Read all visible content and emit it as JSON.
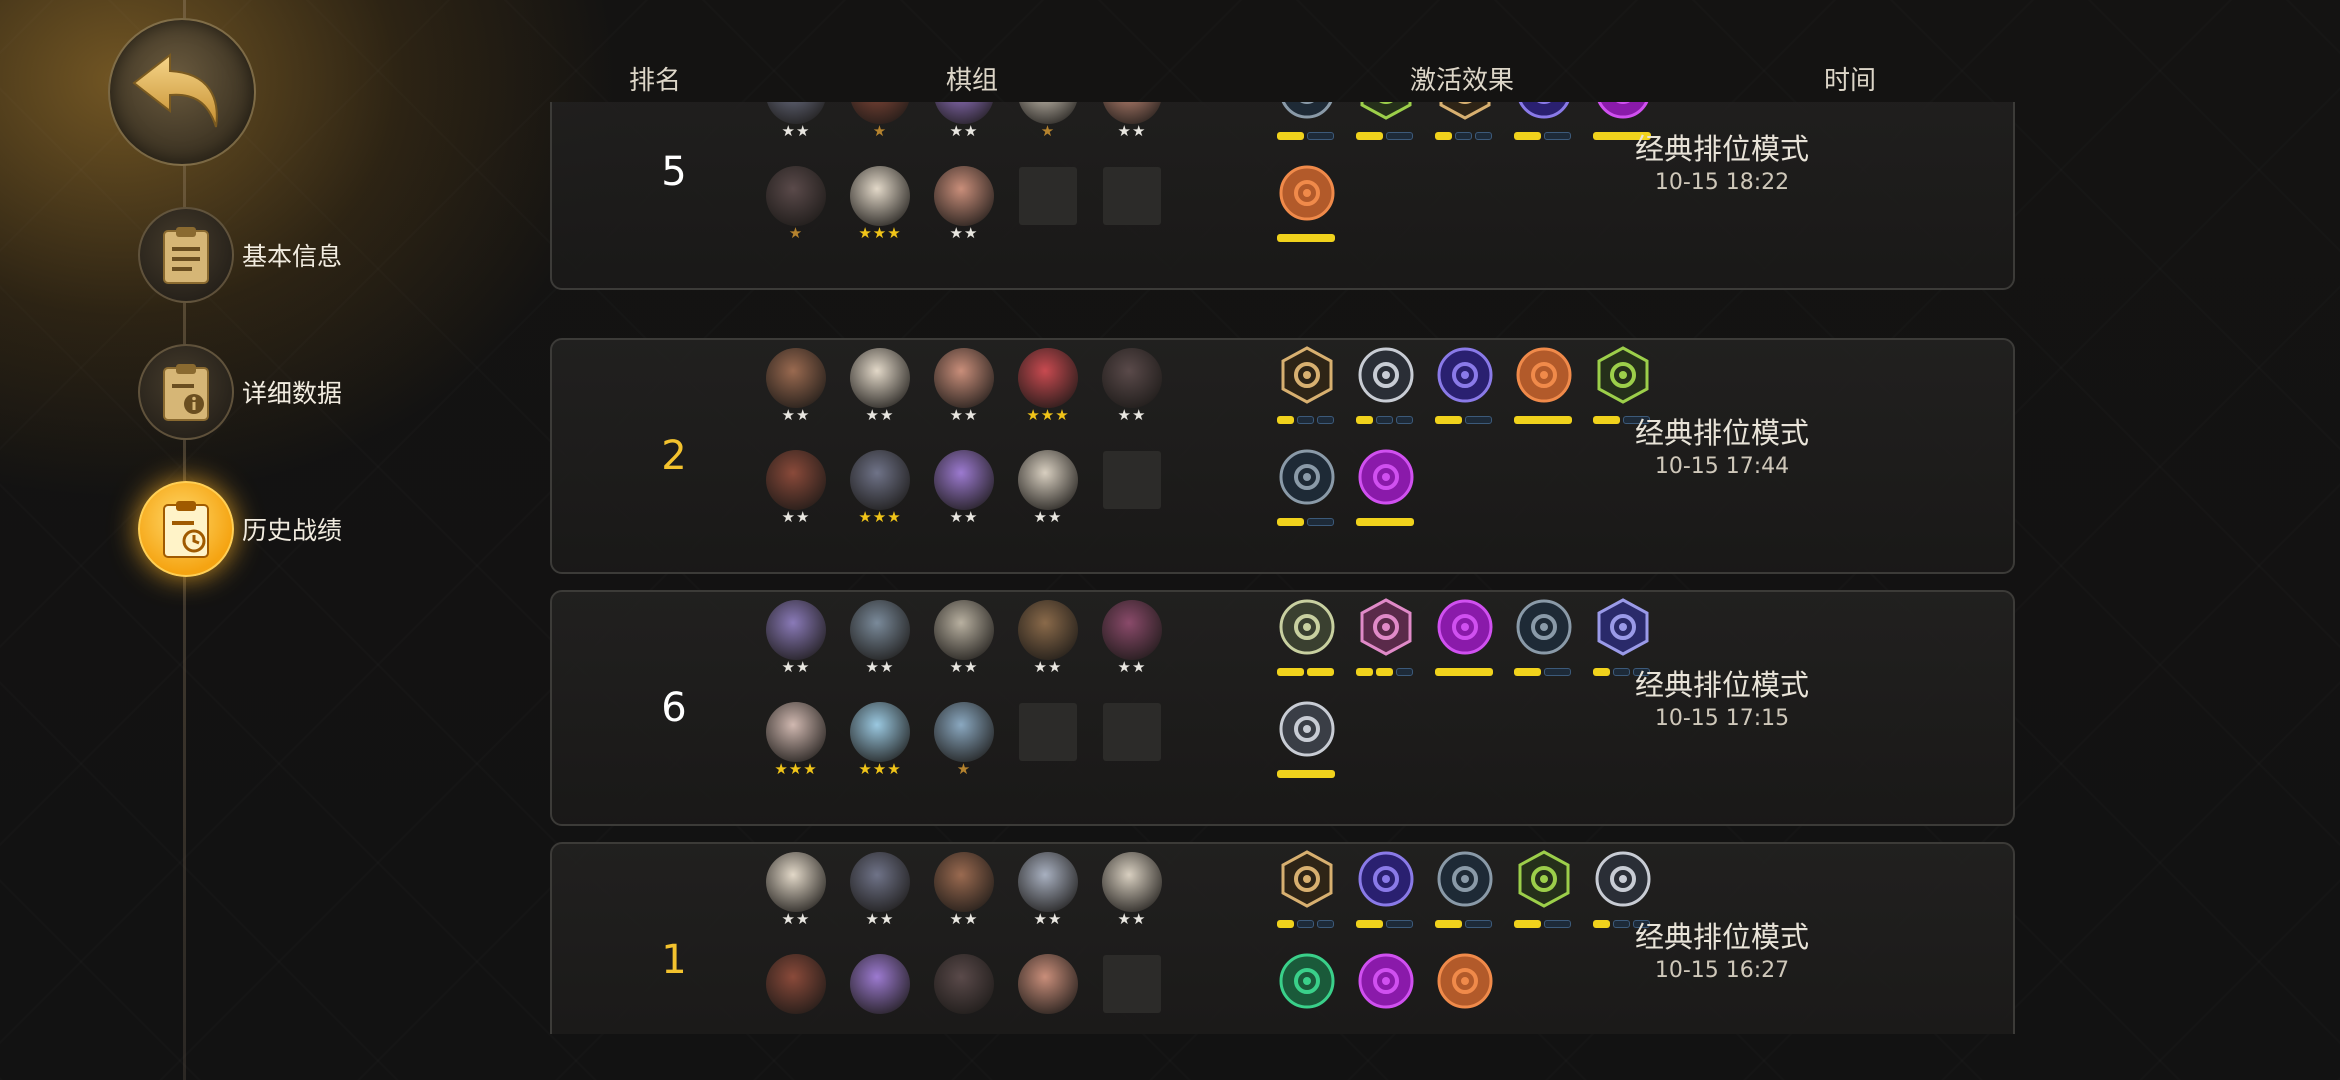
{
  "nav": {
    "back_icon": "back-arrow-icon",
    "items": [
      {
        "label": "基本信息",
        "icon": "clipboard-icon",
        "active": false
      },
      {
        "label": "详细数据",
        "icon": "clipboard-info-icon",
        "active": false
      },
      {
        "label": "历史战绩",
        "icon": "clipboard-clock-icon",
        "active": true
      }
    ]
  },
  "header": {
    "rank": "排名",
    "lineup": "棋组",
    "traits": "激活效果",
    "time": "时间"
  },
  "colors": {
    "accent": "#f3c22e",
    "bar_on": "#f0d21c",
    "bar_off": "#1d2a38"
  },
  "matches": [
    {
      "rank": "5",
      "gold": false,
      "mode": "经典排位模式",
      "time": "10-15 18:22",
      "units": [
        {
          "stars": "★★",
          "star_color": "white",
          "color": "#6f7388"
        },
        {
          "stars": "★",
          "star_color": "bronze",
          "color": "#8a4a3a"
        },
        {
          "stars": "★★",
          "star_color": "white",
          "color": "#9c7ad0"
        },
        {
          "stars": "★",
          "star_color": "bronze",
          "color": "#d8cfc0"
        },
        {
          "stars": "★★",
          "star_color": "white",
          "color": "#c98e7a"
        },
        {
          "stars": "★",
          "star_color": "bronze",
          "color": "#5a4a4a"
        },
        {
          "stars": "★★★",
          "star_color": "gold",
          "color": "#e2d8c8"
        },
        {
          "stars": "★★",
          "star_color": "white",
          "color": "#c98e7a"
        },
        {
          "empty": true
        },
        {
          "empty": true
        }
      ],
      "traits": [
        {
          "icon": "paw-prints-icon",
          "shape": "circle",
          "color": "#8a9aa8",
          "fill": "#1e2a36",
          "bars": [
            1,
            0
          ]
        },
        {
          "icon": "bow-icon",
          "shape": "hex",
          "color": "#9ccf4a",
          "fill": "#25301a",
          "bars": [
            1,
            0
          ]
        },
        {
          "icon": "axe-icon",
          "shape": "hex",
          "color": "#d8b070",
          "fill": "#2e2416",
          "bars": [
            1,
            0,
            0
          ]
        },
        {
          "icon": "fish-bone-icon",
          "shape": "circle",
          "color": "#8a7ae8",
          "fill": "#2a2070",
          "bars": [
            1,
            0
          ]
        },
        {
          "icon": "demon-skull-icon",
          "shape": "circle",
          "color": "#d050f0",
          "fill": "#8a1aaa",
          "bars": [
            1
          ]
        },
        {
          "icon": "goblin-icon",
          "shape": "circle",
          "color": "#f08a4a",
          "fill": "#b25a2a",
          "bars": [
            1
          ]
        }
      ]
    },
    {
      "rank": "2",
      "gold": true,
      "mode": "经典排位模式",
      "time": "10-15 17:44",
      "units": [
        {
          "stars": "★★",
          "star_color": "white",
          "color": "#9a6a50"
        },
        {
          "stars": "★★",
          "star_color": "white",
          "color": "#e2d8c8"
        },
        {
          "stars": "★★",
          "star_color": "white",
          "color": "#c98e7a"
        },
        {
          "stars": "★★★",
          "star_color": "gold",
          "color": "#c84a50"
        },
        {
          "stars": "★★",
          "star_color": "white",
          "color": "#5a4a4a"
        },
        {
          "stars": "★★",
          "star_color": "white",
          "color": "#8a4a3a"
        },
        {
          "stars": "★★★",
          "star_color": "gold",
          "color": "#6f7388"
        },
        {
          "stars": "★★",
          "star_color": "white",
          "color": "#9c7ad0"
        },
        {
          "stars": "★★",
          "star_color": "white",
          "color": "#d8cfc0"
        },
        {
          "empty": true
        }
      ],
      "traits": [
        {
          "icon": "axe-icon",
          "shape": "hex",
          "color": "#d8b070",
          "fill": "#2e2416",
          "bars": [
            1,
            0,
            0
          ]
        },
        {
          "icon": "human-icon",
          "shape": "circle",
          "color": "#c8ccd4",
          "fill": "#2a2e36",
          "bars": [
            1,
            0,
            0
          ]
        },
        {
          "icon": "fish-bone-icon",
          "shape": "circle",
          "color": "#8a7ae8",
          "fill": "#2a2070",
          "bars": [
            1,
            0
          ]
        },
        {
          "icon": "goblin-icon",
          "shape": "circle",
          "color": "#f08a4a",
          "fill": "#b25a2a",
          "bars": [
            1
          ]
        },
        {
          "icon": "bow-icon",
          "shape": "hex",
          "color": "#9ccf4a",
          "fill": "#25301a",
          "bars": [
            1,
            0
          ]
        },
        {
          "icon": "paw-prints-icon",
          "shape": "circle",
          "color": "#8a9aa8",
          "fill": "#1e2a36",
          "bars": [
            1,
            0
          ]
        },
        {
          "icon": "demon-skull-icon",
          "shape": "circle",
          "color": "#d050f0",
          "fill": "#8a1aaa",
          "bars": [
            1
          ]
        }
      ]
    },
    {
      "rank": "6",
      "gold": false,
      "mode": "经典排位模式",
      "time": "10-15 17:15",
      "units": [
        {
          "stars": "★★",
          "star_color": "white",
          "color": "#8a7ab8"
        },
        {
          "stars": "★★",
          "star_color": "white",
          "color": "#7a8a9a"
        },
        {
          "stars": "★★",
          "star_color": "white",
          "color": "#b8b0a0"
        },
        {
          "stars": "★★",
          "star_color": "white",
          "color": "#8a6a4a"
        },
        {
          "stars": "★★",
          "star_color": "white",
          "color": "#8a4a6a"
        },
        {
          "stars": "★★★",
          "star_color": "gold",
          "color": "#d0b8b0"
        },
        {
          "stars": "★★★",
          "star_color": "gold",
          "color": "#9ac8e0"
        },
        {
          "stars": "★",
          "star_color": "bronze",
          "color": "#8aa8c0"
        },
        {
          "empty": true
        },
        {
          "empty": true
        }
      ],
      "traits": [
        {
          "icon": "beast-icon",
          "shape": "circle",
          "color": "#c8d0a0",
          "fill": "#3a4030",
          "bars": [
            1,
            1
          ]
        },
        {
          "icon": "knight-icon",
          "shape": "hex",
          "color": "#e08ac8",
          "fill": "#5a2a4a",
          "bars": [
            1,
            1,
            0
          ]
        },
        {
          "icon": "demon-skull-icon",
          "shape": "circle",
          "color": "#d050f0",
          "fill": "#8a1aaa",
          "bars": [
            1
          ]
        },
        {
          "icon": "paw-prints-icon",
          "shape": "circle",
          "color": "#8a9aa8",
          "fill": "#1e2a36",
          "bars": [
            1,
            0
          ]
        },
        {
          "icon": "mech-icon",
          "shape": "hex",
          "color": "#9a9ae8",
          "fill": "#2a2a6a",
          "bars": [
            1,
            0,
            0
          ]
        },
        {
          "icon": "cross-icon",
          "shape": "circle",
          "color": "#c8ccd4",
          "fill": "#3a3e46",
          "bars": [
            1
          ]
        }
      ]
    },
    {
      "rank": "1",
      "gold": true,
      "mode": "经典排位模式",
      "time": "10-15 16:27",
      "units": [
        {
          "stars": "★★",
          "star_color": "white",
          "color": "#e2d8c8"
        },
        {
          "stars": "★★",
          "star_color": "white",
          "color": "#6f7388"
        },
        {
          "stars": "★★",
          "star_color": "white",
          "color": "#9a6a50"
        },
        {
          "stars": "★★",
          "star_color": "white",
          "color": "#a8b0c0"
        },
        {
          "stars": "★★",
          "star_color": "white",
          "color": "#d8cfc0"
        },
        {
          "stars": "",
          "star_color": "white",
          "color": "#8a4a3a"
        },
        {
          "stars": "",
          "star_color": "white",
          "color": "#9c7ad0"
        },
        {
          "stars": "",
          "star_color": "white",
          "color": "#5a4a4a"
        },
        {
          "stars": "",
          "star_color": "white",
          "color": "#c98e7a"
        },
        {
          "empty": true
        }
      ],
      "traits": [
        {
          "icon": "axe-icon",
          "shape": "hex",
          "color": "#d8b070",
          "fill": "#2e2416",
          "bars": [
            1,
            0,
            0
          ]
        },
        {
          "icon": "fish-bone-icon",
          "shape": "circle",
          "color": "#8a7ae8",
          "fill": "#2a2070",
          "bars": [
            1,
            0
          ]
        },
        {
          "icon": "paw-prints-icon",
          "shape": "circle",
          "color": "#8a9aa8",
          "fill": "#1e2a36",
          "bars": [
            1,
            0
          ]
        },
        {
          "icon": "bow-icon",
          "shape": "hex",
          "color": "#9ccf4a",
          "fill": "#25301a",
          "bars": [
            1,
            0
          ]
        },
        {
          "icon": "human-icon",
          "shape": "circle",
          "color": "#c8ccd4",
          "fill": "#2a2e36",
          "bars": [
            1,
            0,
            0
          ]
        },
        {
          "icon": "paw-icon",
          "shape": "circle",
          "color": "#3ad08a",
          "fill": "#1a5a3a",
          "bars": []
        },
        {
          "icon": "demon-skull-icon",
          "shape": "circle",
          "color": "#d050f0",
          "fill": "#8a1aaa",
          "bars": []
        },
        {
          "icon": "goblin-icon",
          "shape": "circle",
          "color": "#f08a4a",
          "fill": "#b25a2a",
          "bars": []
        }
      ]
    }
  ]
}
